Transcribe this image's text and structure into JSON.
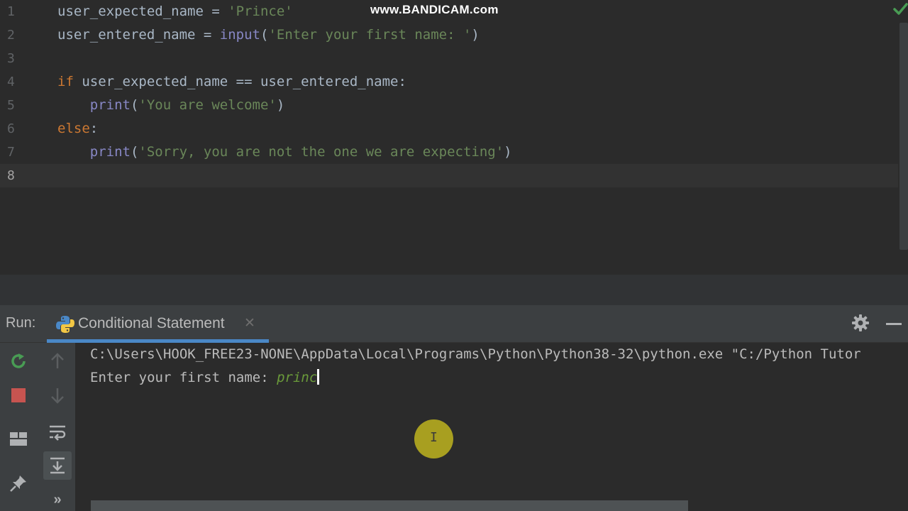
{
  "watermark": "www.BANDICAM.com",
  "editor": {
    "lines": [
      {
        "num": "1",
        "parts": [
          {
            "t": "user_expected_name = ",
            "c": "plain"
          },
          {
            "t": "'Prince'",
            "c": "str"
          }
        ]
      },
      {
        "num": "2",
        "parts": [
          {
            "t": "user_entered_name = ",
            "c": "plain"
          },
          {
            "t": "input",
            "c": "bi"
          },
          {
            "t": "(",
            "c": "plain"
          },
          {
            "t": "'Enter your first name: '",
            "c": "str"
          },
          {
            "t": ")",
            "c": "plain"
          }
        ]
      },
      {
        "num": "3",
        "parts": []
      },
      {
        "num": "4",
        "parts": [
          {
            "t": "if ",
            "c": "kw"
          },
          {
            "t": "user_expected_name == user_entered_name:",
            "c": "plain"
          }
        ]
      },
      {
        "num": "5",
        "parts": [
          {
            "t": "    print",
            "c": "bi"
          },
          {
            "t": "(",
            "c": "plain"
          },
          {
            "t": "'You are welcome'",
            "c": "str"
          },
          {
            "t": ")",
            "c": "plain"
          }
        ]
      },
      {
        "num": "6",
        "parts": [
          {
            "t": "else",
            "c": "kw"
          },
          {
            "t": ":",
            "c": "plain"
          }
        ]
      },
      {
        "num": "7",
        "parts": [
          {
            "t": "    print",
            "c": "bi"
          },
          {
            "t": "(",
            "c": "plain"
          },
          {
            "t": "'Sorry, you are not the one we are expecting'",
            "c": "str"
          },
          {
            "t": ")",
            "c": "plain"
          }
        ]
      },
      {
        "num": "8",
        "parts": []
      }
    ],
    "current_line": 8
  },
  "run_panel": {
    "label": "Run:",
    "tab_title": "Conditional Statement",
    "tab_close": "✕",
    "console_command": "C:\\Users\\HOOK_FREE23-NONE\\AppData\\Local\\Programs\\Python\\Python38-32\\python.exe \"C:/Python Tutor",
    "prompt": "Enter your first name: ",
    "user_input": "princ",
    "toolbar_more": "»"
  },
  "colors": {
    "background": "#2b2b2b",
    "keyword": "#cc7832",
    "string": "#6a8759",
    "builtin": "#8888c6",
    "tab_accent": "#4a88c7",
    "rerun_green": "#499c54",
    "stop_red": "#c75450"
  },
  "icons": [
    "check-icon",
    "python-icon",
    "gear-icon",
    "minimize-icon",
    "rerun-icon",
    "stop-icon",
    "up-arrow-icon",
    "down-arrow-icon",
    "soft-wrap-icon",
    "scroll-to-end-icon",
    "layout-icon",
    "pin-icon",
    "more-icon"
  ]
}
